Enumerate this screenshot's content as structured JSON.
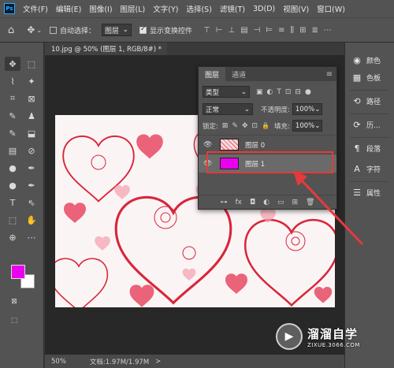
{
  "menubar": {
    "logo": "Ps",
    "items": [
      "文件(F)",
      "编辑(E)",
      "图像(I)",
      "图层(L)",
      "文字(Y)",
      "选择(S)",
      "滤镜(T)",
      "3D(D)",
      "视图(V)",
      "窗口(W)"
    ]
  },
  "options": {
    "home_icon": "⌂",
    "move_icon": "✥",
    "dropdown_icon": "⌄",
    "auto_select_label": "自动选择：",
    "auto_select_value": "图层",
    "show_transform_label": "显示变换控件",
    "align_icons": [
      "⊤",
      "⊢",
      "⊥",
      "▤",
      "⊣",
      "⊨",
      "≡",
      "⫼",
      "⊞",
      "≣",
      "⋯"
    ]
  },
  "toolbox": {
    "tools": [
      "✥",
      "⬚",
      "⌇",
      "✦",
      "⌗",
      "⊠",
      "✎",
      "♟",
      "✎",
      "⬓",
      "▤",
      "⊘",
      "●",
      "✒",
      "T",
      "⇖",
      "✋",
      "⊕",
      "⋯"
    ],
    "fg_color": "#ea00ef",
    "bg_color": "#ffffff"
  },
  "document": {
    "tab_title": "10.jpg @ 50% (图层 1, RGB/8#) *",
    "close": "×",
    "zoom": "50%",
    "doc_info": "文档:1.97M/1.97M",
    "arrow": ">"
  },
  "right_panel": {
    "items": [
      {
        "icon": "◉",
        "label": "颜色"
      },
      {
        "icon": "▦",
        "label": "色板"
      },
      {
        "icon": "⟲",
        "label": "路径"
      },
      {
        "icon": "⟳",
        "label": "历..."
      },
      {
        "icon": "¶",
        "label": "段落"
      },
      {
        "icon": "A",
        "label": "字符"
      },
      {
        "icon": "☰",
        "label": "属性"
      }
    ]
  },
  "layers_panel": {
    "tab_active": "图层",
    "tab_other": "通道",
    "menu_icon": "≡",
    "filter_label": "类型",
    "filter_icons": [
      "▣",
      "◐",
      "T",
      "⊡",
      "⊟",
      "●"
    ],
    "blend_mode": "正常",
    "opacity_label": "不透明度:",
    "opacity_value": "100%",
    "lock_label": "锁定:",
    "lock_icons": [
      "⊠",
      "✎",
      "✥",
      "⊡",
      "🔒"
    ],
    "fill_label": "填充:",
    "fill_value": "100%",
    "layers": [
      {
        "name": "图层 0",
        "visible": true
      },
      {
        "name": "图层 1",
        "visible": true,
        "selected": true,
        "color": "#ea00ef"
      }
    ],
    "footer_icons": [
      "⊶",
      "fx",
      "◘",
      "◐",
      "▭",
      "⊞",
      "🗑"
    ]
  },
  "annotation": {
    "highlight_color": "#e63a3a"
  },
  "watermark": {
    "title": "溜溜自学",
    "url": "ZIXUE.3066.COM",
    "icon": "▶"
  }
}
